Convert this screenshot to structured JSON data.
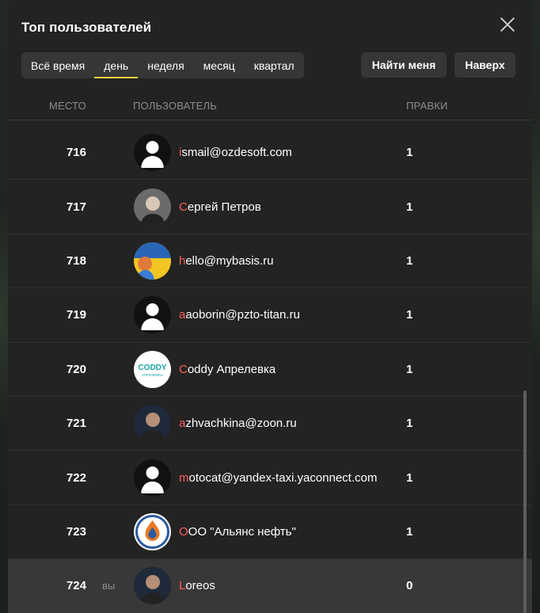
{
  "title": "Топ пользователей",
  "periods": [
    "Всё время",
    "день",
    "неделя",
    "месяц",
    "квартал"
  ],
  "active_period": 1,
  "buttons": {
    "find_me": "Найти меня",
    "to_top": "Наверх"
  },
  "columns": {
    "place": "Место",
    "user": "Пользователь",
    "edits": "Правки"
  },
  "rows": [
    {
      "rank": "716",
      "first": "i",
      "rest": "smail@ozdesoft.com",
      "edits": "1",
      "avatar": "default-avatar"
    },
    {
      "rank": "717",
      "first": "С",
      "rest": "ергей Петров",
      "edits": "1",
      "avatar": "photo-avatar"
    },
    {
      "rank": "718",
      "first": "h",
      "rest": "ello@mybasis.ru",
      "edits": "1",
      "avatar": "poster-avatar"
    },
    {
      "rank": "719",
      "first": "a",
      "rest": "aoborin@pzto-titan.ru",
      "edits": "1",
      "avatar": "default-avatar"
    },
    {
      "rank": "720",
      "first": "C",
      "rest": "oddy Апрелевка",
      "edits": "1",
      "avatar": "coddy-logo-avatar"
    },
    {
      "rank": "721",
      "first": "a",
      "rest": "zhvachkina@zoon.ru",
      "edits": "1",
      "avatar": "photo-avatar"
    },
    {
      "rank": "722",
      "first": "m",
      "rest": "otocat@yandex-taxi.yaconnect.com",
      "edits": "1",
      "avatar": "default-avatar"
    },
    {
      "rank": "723",
      "first": "О",
      "rest": "ОО \"Альянс нефть\"",
      "edits": "1",
      "avatar": "flame-logo-avatar"
    },
    {
      "rank": "724",
      "first": "L",
      "rest": "oreos",
      "edits": "0",
      "avatar": "photo-avatar",
      "you": "вы"
    }
  ],
  "coddy_logo": {
    "line1": "CODDY",
    "line2": "АПРЕЛЕВКА"
  }
}
